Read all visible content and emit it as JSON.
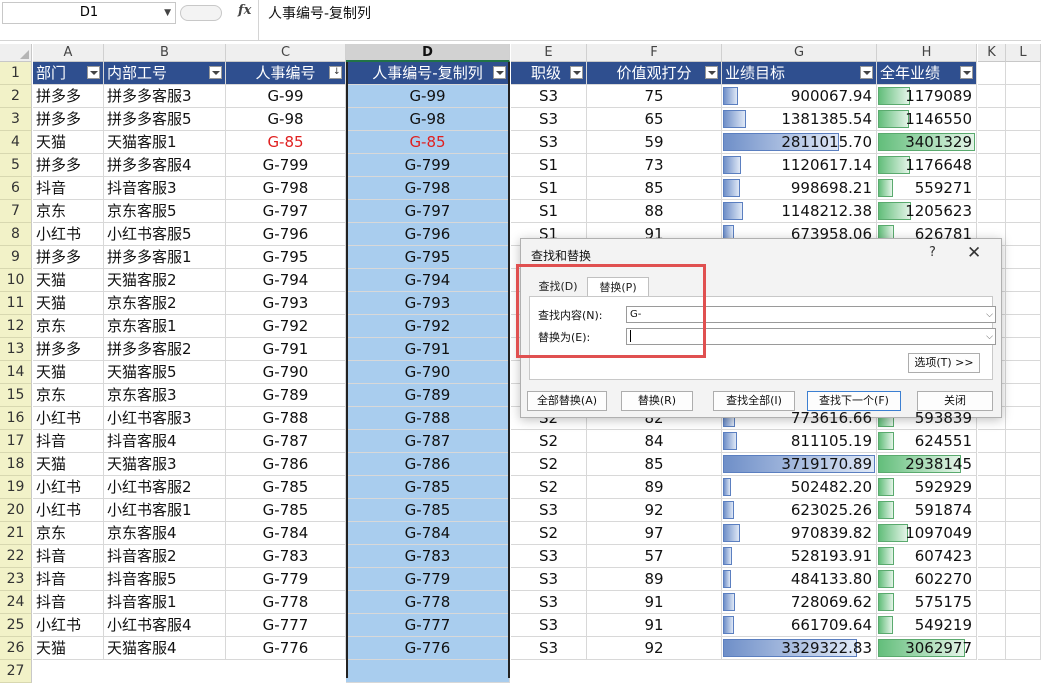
{
  "formula_bar": {
    "name_box": "D1",
    "fx_label": "fx",
    "formula": "人事编号-复制列"
  },
  "columns": [
    "A",
    "B",
    "C",
    "D",
    "E",
    "F",
    "G",
    "H",
    "K",
    "L"
  ],
  "header_row": {
    "row_number": "1",
    "cells": [
      "部门",
      "内部工号",
      "人事编号",
      "人事编号-复制列",
      "职级",
      "价值观打分",
      "业绩目标",
      "全年业绩"
    ]
  },
  "rows": [
    {
      "n": "2",
      "dept": "拼多多",
      "agent": "拼多多客服3",
      "id": "G-99",
      "copy": "G-99",
      "level": "S3",
      "score": "75",
      "target": "900067.94",
      "target_pct": 0.1,
      "actual": "1179089",
      "actual_pct": 0.33
    },
    {
      "n": "3",
      "dept": "拼多多",
      "agent": "拼多多客服5",
      "id": "G-98",
      "copy": "G-98",
      "level": "S3",
      "score": "65",
      "target": "1381385.54",
      "target_pct": 0.15,
      "actual": "1146550",
      "actual_pct": 0.32
    },
    {
      "n": "4",
      "dept": "天猫",
      "agent": "天猫客服1",
      "id": "G-85",
      "copy": "G-85",
      "level": "S3",
      "score": "59",
      "target": "2811015.70",
      "target_pct": 0.76,
      "actual": "3401329",
      "actual_pct": 1.0,
      "red": true
    },
    {
      "n": "5",
      "dept": "拼多多",
      "agent": "拼多多客服4",
      "id": "G-799",
      "copy": "G-799",
      "level": "S1",
      "score": "73",
      "target": "1120617.14",
      "target_pct": 0.12,
      "actual": "1176648",
      "actual_pct": 0.33
    },
    {
      "n": "6",
      "dept": "抖音",
      "agent": "抖音客服3",
      "id": "G-798",
      "copy": "G-798",
      "level": "S1",
      "score": "85",
      "target": "998698.21",
      "target_pct": 0.11,
      "actual": "559271",
      "actual_pct": 0.15
    },
    {
      "n": "7",
      "dept": "京东",
      "agent": "京东客服5",
      "id": "G-797",
      "copy": "G-797",
      "level": "S1",
      "score": "88",
      "target": "1148212.38",
      "target_pct": 0.13,
      "actual": "1205623",
      "actual_pct": 0.34
    },
    {
      "n": "8",
      "dept": "小红书",
      "agent": "小红书客服5",
      "id": "G-796",
      "copy": "G-796",
      "level": "S1",
      "score": "91",
      "target": "673958.06",
      "target_pct": 0.07,
      "actual": "626781",
      "actual_pct": 0.17
    },
    {
      "n": "9",
      "dept": "拼多多",
      "agent": "拼多多客服1",
      "id": "G-795",
      "copy": "G-795",
      "level": "",
      "score": "",
      "target": "",
      "target_pct": 0,
      "actual": "",
      "actual_pct": 0
    },
    {
      "n": "10",
      "dept": "天猫",
      "agent": "天猫客服2",
      "id": "G-794",
      "copy": "G-794",
      "level": "",
      "score": "",
      "target": "",
      "target_pct": 0,
      "actual": "",
      "actual_pct": 0
    },
    {
      "n": "11",
      "dept": "天猫",
      "agent": "京东客服2",
      "id": "G-793",
      "copy": "G-793",
      "level": "",
      "score": "",
      "target": "",
      "target_pct": 0,
      "actual": "",
      "actual_pct": 0
    },
    {
      "n": "12",
      "dept": "京东",
      "agent": "京东客服1",
      "id": "G-792",
      "copy": "G-792",
      "level": "",
      "score": "",
      "target": "",
      "target_pct": 0,
      "actual": "",
      "actual_pct": 0
    },
    {
      "n": "13",
      "dept": "拼多多",
      "agent": "拼多多客服2",
      "id": "G-791",
      "copy": "G-791",
      "level": "",
      "score": "",
      "target": "",
      "target_pct": 0,
      "actual": "",
      "actual_pct": 0
    },
    {
      "n": "14",
      "dept": "天猫",
      "agent": "天猫客服5",
      "id": "G-790",
      "copy": "G-790",
      "level": "",
      "score": "",
      "target": "",
      "target_pct": 0,
      "actual": "",
      "actual_pct": 0
    },
    {
      "n": "15",
      "dept": "京东",
      "agent": "京东客服3",
      "id": "G-789",
      "copy": "G-789",
      "level": "",
      "score": "",
      "target": "",
      "target_pct": 0,
      "actual": "",
      "actual_pct": 0
    },
    {
      "n": "16",
      "dept": "小红书",
      "agent": "小红书客服3",
      "id": "G-788",
      "copy": "G-788",
      "level": "S2",
      "score": "82",
      "target": "773616.66",
      "target_pct": 0.08,
      "actual": "593839",
      "actual_pct": 0.16
    },
    {
      "n": "17",
      "dept": "抖音",
      "agent": "抖音客服4",
      "id": "G-787",
      "copy": "G-787",
      "level": "S2",
      "score": "84",
      "target": "811105.19",
      "target_pct": 0.09,
      "actual": "624551",
      "actual_pct": 0.17
    },
    {
      "n": "18",
      "dept": "天猫",
      "agent": "天猫客服3",
      "id": "G-786",
      "copy": "G-786",
      "level": "S2",
      "score": "85",
      "target": "3719170.89",
      "target_pct": 1.0,
      "actual": "2938145",
      "actual_pct": 0.86
    },
    {
      "n": "19",
      "dept": "小红书",
      "agent": "小红书客服2",
      "id": "G-785",
      "copy": "G-785",
      "level": "S2",
      "score": "89",
      "target": "502482.20",
      "target_pct": 0.05,
      "actual": "592929",
      "actual_pct": 0.16
    },
    {
      "n": "20",
      "dept": "小红书",
      "agent": "小红书客服1",
      "id": "G-785",
      "copy": "G-785",
      "level": "S3",
      "score": "92",
      "target": "623025.26",
      "target_pct": 0.07,
      "actual": "591874",
      "actual_pct": 0.16
    },
    {
      "n": "21",
      "dept": "京东",
      "agent": "京东客服4",
      "id": "G-784",
      "copy": "G-784",
      "level": "S2",
      "score": "97",
      "target": "970839.82",
      "target_pct": 0.11,
      "actual": "1097049",
      "actual_pct": 0.31
    },
    {
      "n": "22",
      "dept": "抖音",
      "agent": "抖音客服2",
      "id": "G-783",
      "copy": "G-783",
      "level": "S3",
      "score": "57",
      "target": "528193.91",
      "target_pct": 0.06,
      "actual": "607423",
      "actual_pct": 0.17
    },
    {
      "n": "23",
      "dept": "抖音",
      "agent": "抖音客服5",
      "id": "G-779",
      "copy": "G-779",
      "level": "S3",
      "score": "89",
      "target": "484133.80",
      "target_pct": 0.05,
      "actual": "602270",
      "actual_pct": 0.16
    },
    {
      "n": "24",
      "dept": "抖音",
      "agent": "抖音客服1",
      "id": "G-778",
      "copy": "G-778",
      "level": "S3",
      "score": "91",
      "target": "728069.62",
      "target_pct": 0.08,
      "actual": "575175",
      "actual_pct": 0.16
    },
    {
      "n": "25",
      "dept": "小红书",
      "agent": "小红书客服4",
      "id": "G-777",
      "copy": "G-777",
      "level": "S3",
      "score": "91",
      "target": "661709.64",
      "target_pct": 0.07,
      "actual": "549219",
      "actual_pct": 0.15
    },
    {
      "n": "26",
      "dept": "天猫",
      "agent": "天猫客服4",
      "id": "G-776",
      "copy": "G-776",
      "level": "S3",
      "score": "92",
      "target": "3329322.83",
      "target_pct": 0.88,
      "actual": "3062977",
      "actual_pct": 0.9
    }
  ],
  "last_row_number": "27",
  "dialog": {
    "title": "查找和替换",
    "help": "?",
    "close": "✕",
    "tab_find": "查找(D)",
    "tab_replace": "替换(P)",
    "find_label": "查找内容(N):",
    "find_value": "G-",
    "replace_label": "替换为(E):",
    "replace_value": "",
    "options_button": "选项(T) >>",
    "replace_all_button": "全部替换(A)",
    "replace_button": "替换(R)",
    "find_all_button": "查找全部(I)",
    "find_next_button": "查找下一个(F)",
    "close_button": "关闭"
  },
  "colors": {
    "header_bg": "#2f4f8f",
    "selected_col": "#a9cdee",
    "red_text": "#e02020",
    "highlight": "#e05050"
  }
}
